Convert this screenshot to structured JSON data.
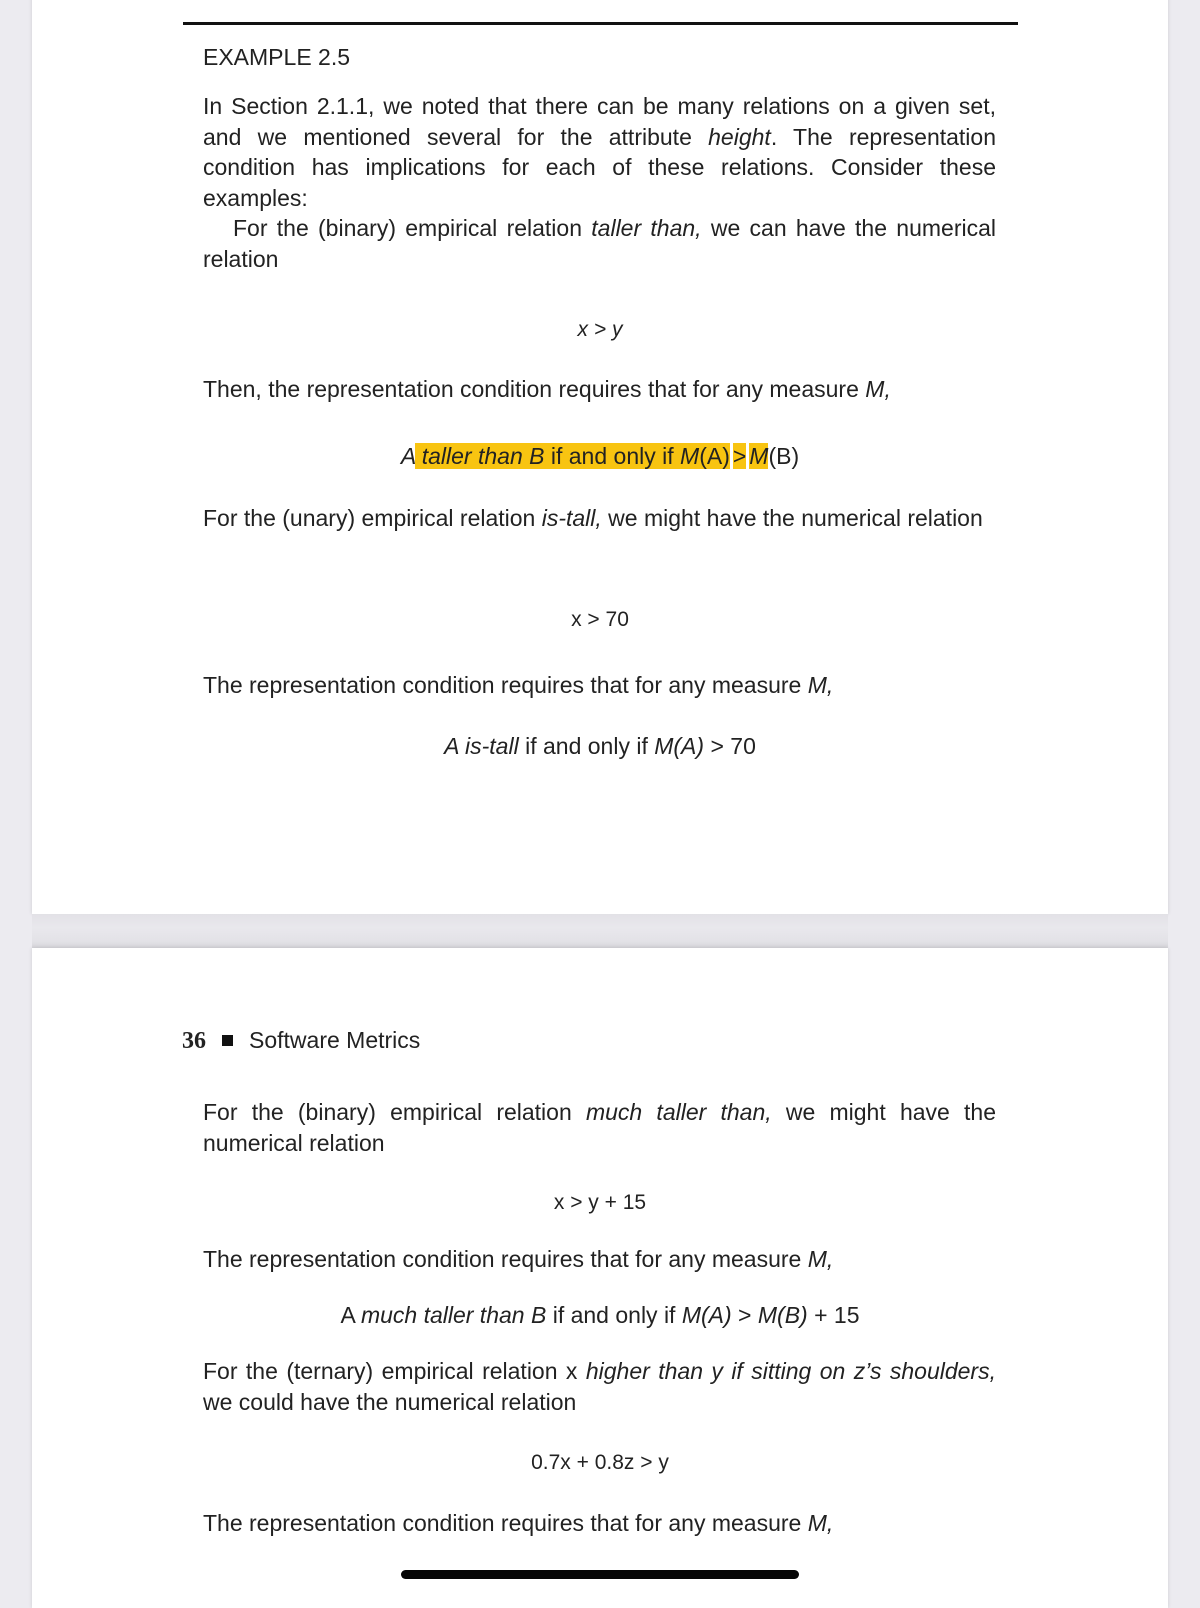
{
  "page1": {
    "heading": "EXAMPLE 2.5",
    "intro": {
      "p1_a": "In Section 2.1.1, we noted that there can be many relations on a given set, and we mentioned several for the attribute ",
      "p1_em": "height",
      "p1_b": ". The representation condition has implications for each of these relations. Consider these examples:",
      "p2_a": "For the (binary) empirical relation ",
      "p2_em": "taller than,",
      "p2_b": " we can have the numerical relation"
    },
    "formula1": "x > y",
    "then_text_a": "Then, the representation condition requires that for any measure ",
    "then_text_em": "M,",
    "highlight_line": {
      "A": "A",
      "em1": " taller than B",
      "mid": " if and only if ",
      "em2": "M",
      "paren1": "(A)",
      "gt": ">",
      "em3": "M",
      "paren2": "(B)"
    },
    "unary_a": "For the (unary) empirical relation ",
    "unary_em": "is-tall,",
    "unary_b": " we might have the numerical relation",
    "formula2": "x > 70",
    "rep_a": "The representation condition requires that for any measure ",
    "rep_em": "M,",
    "istall_line": {
      "em1": "A is-tall",
      "mid": " if and only if ",
      "em2": "M(A)",
      "end": " > 70"
    }
  },
  "page2": {
    "page_number": "36",
    "running_title": "Software Metrics",
    "much_a": "For the (binary) empirical relation ",
    "much_em": "much taller than,",
    "much_b": " we might have the numerical relation",
    "formula3": "x > y + 15",
    "rep_a": "The representation condition requires that for any measure ",
    "rep_em": "M,",
    "much_line": {
      "a": "A ",
      "em1": "much taller than B",
      "mid": " if and only if ",
      "em2": "M(A)",
      "gt": " > ",
      "em3": "M(B)",
      "end": " + 15"
    },
    "ternary_a": "For the (ternary) empirical relation x ",
    "ternary_em": "higher than y if sitting on z’s shoulders,",
    "ternary_b": " we could have the numerical relation",
    "formula4": "0.7x + 0.8z > y",
    "rep2_a": "The representation condition requires that for any measure ",
    "rep2_em": "M,"
  },
  "colors": {
    "highlight": "#f8c411"
  }
}
